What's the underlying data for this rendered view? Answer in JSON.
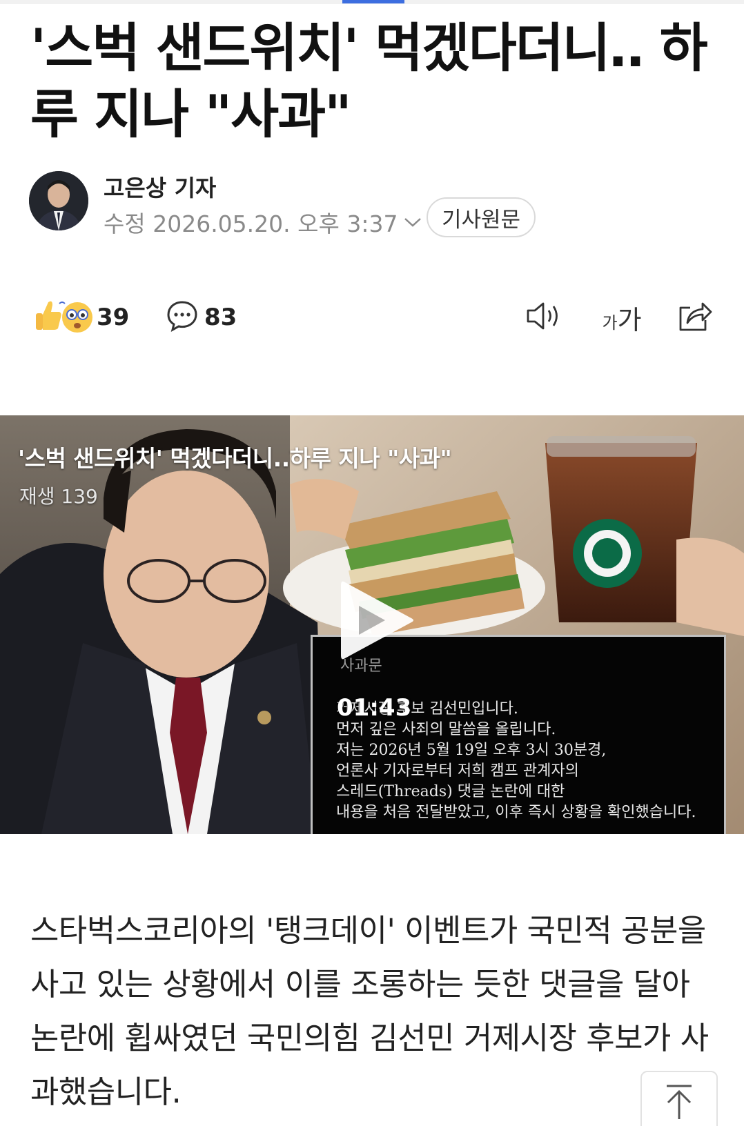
{
  "article": {
    "headline": "'스벅 샌드위치' 먹겠다더니‥ 하루 지나 \"사과\"",
    "author": "고은상 기자",
    "modified": "수정 2026.05.20. 오후 3:37",
    "original_button": "기사원문"
  },
  "actions": {
    "reaction_count": "39",
    "comment_count": "83",
    "tts": "speaker-icon",
    "font_size_label_small": "가",
    "font_size_label_large": "가",
    "share": "share-icon"
  },
  "video": {
    "title": "'스벅 샌드위치' 먹겠다더니..하루 지나 \"사과\"",
    "plays": "재생 139",
    "duration": "01:43",
    "apology_label": "사과문",
    "apology_lines": [
      "거제시장 후보 김선민입니다.",
      "먼저 깊은 사죄의 말씀을 올립니다.",
      "저는 2026년 5월 19일 오후 3시 30분경,",
      "언론사 기자로부터 저희 캠프 관계자의",
      "스레드(Threads) 댓글 논란에 대한",
      "내용을 처음 전달받았고, 이후 즉시 상황을 확인했습니다."
    ]
  },
  "body": {
    "paragraph": "스타벅스코리아의 '탱크데이' 이벤트가 국민적 공분을 사고 있는 상황에서 이를 조롱하는 듯한 댓글을 달아 논란에 휩싸였던 국민의힘 김선민 거제시장 후보가 사과했습니다."
  },
  "colors": {
    "accent": "#3d6ee0",
    "meta_gray": "#8a8a8a",
    "video_bg": "#1e1a18"
  }
}
